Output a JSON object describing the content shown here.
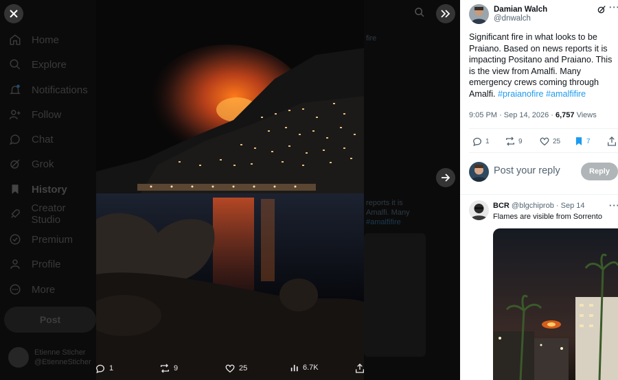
{
  "nav": {
    "items": [
      {
        "label": "Home",
        "icon": "home-icon"
      },
      {
        "label": "Explore",
        "icon": "search-icon"
      },
      {
        "label": "Notifications",
        "icon": "bell-icon"
      },
      {
        "label": "Follow",
        "icon": "follow-icon"
      },
      {
        "label": "Chat",
        "icon": "chat-icon"
      },
      {
        "label": "Grok",
        "icon": "grok-icon"
      },
      {
        "label": "History",
        "icon": "bookmark-icon"
      },
      {
        "label": "Creator Studio",
        "icon": "rocket-icon"
      },
      {
        "label": "Premium",
        "icon": "verified-icon"
      },
      {
        "label": "Profile",
        "icon": "person-icon"
      },
      {
        "label": "More",
        "icon": "more-icon"
      }
    ],
    "post_label": "Post",
    "account_name": "Etienne Sticher",
    "account_handle": "@EtienneSticher"
  },
  "background_fragments": {
    "line1": "reports it is",
    "line2": "Amalfi. Many",
    "hashtag": "#amalfifire",
    "top": "fire"
  },
  "media_bar": {
    "replies": "1",
    "reposts": "9",
    "likes": "25",
    "views": "6.7K"
  },
  "tweet": {
    "author_name": "Damian Walch",
    "author_handle": "@dnwalch",
    "text": "Significant fire in what looks to be Praiano. Based on news reports it is impacting Positano and Praiano. This is the view from Amalfi. Many emergency crews coming through Amalfi.",
    "hashtag1": "#praianofire",
    "hashtag2": "#amalfifire",
    "time": "9:05 PM · Sep 14, 2026 ·",
    "views_count": "6,757",
    "views_label": "Views",
    "replies": "1",
    "reposts": "9",
    "likes": "25",
    "bookmarks": "7"
  },
  "reply_box": {
    "placeholder": "Post your reply",
    "button": "Reply"
  },
  "reply_tweet": {
    "author_name": "BCR",
    "author_handle": "@blgchiprob",
    "date": "· Sep 14",
    "text": "Flames are visible from Sorrento"
  },
  "colors": {
    "accent": "#1d9bf0",
    "panel_bg": "#ffffff",
    "text_secondary": "#536471",
    "reply_button_disabled": "#b0b5b8"
  }
}
